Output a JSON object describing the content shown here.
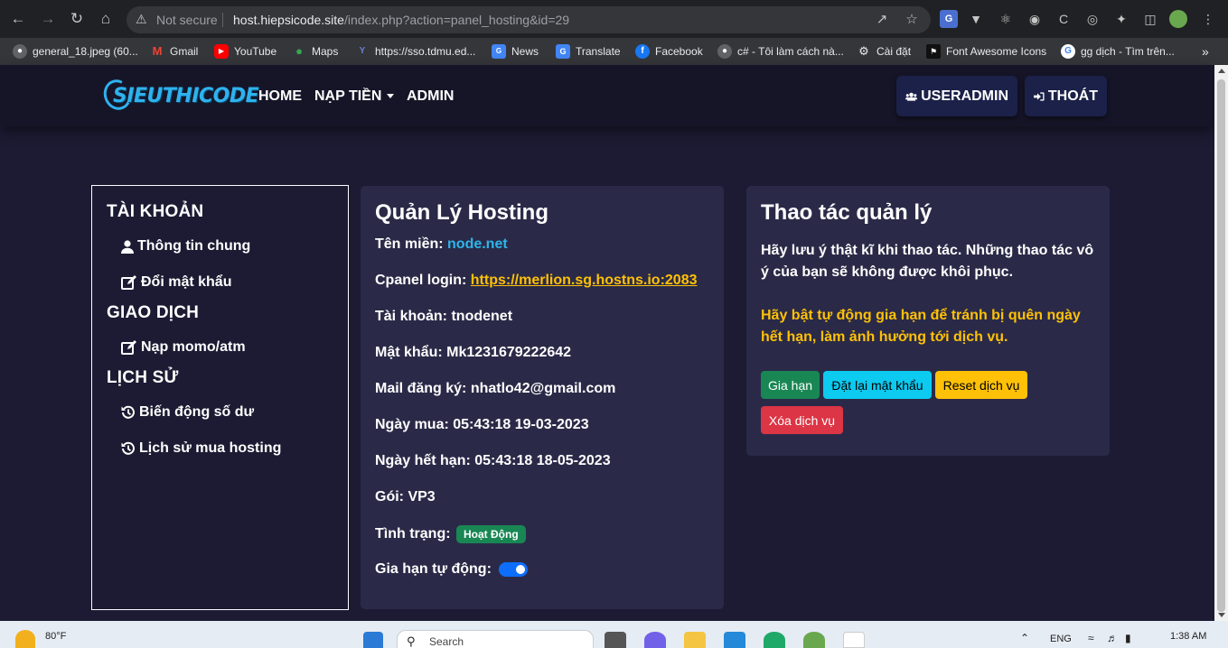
{
  "browser": {
    "not_secure": "Not secure",
    "url_host": "host.hiepsicode.site",
    "url_path": "/index.php?action=panel_hosting&id=29",
    "bookmarks": [
      {
        "label": "general_18.jpeg (60...",
        "icon": "globe-icon",
        "color": "#5f6368"
      },
      {
        "label": "Gmail",
        "icon": "gmail-icon",
        "color": "#ea4335"
      },
      {
        "label": "YouTube",
        "icon": "youtube-icon",
        "color": "#ff0000"
      },
      {
        "label": "Maps",
        "icon": "maps-icon",
        "color": "#34a853"
      },
      {
        "label": "https://sso.tdmu.ed...",
        "icon": "tdmu-icon",
        "color": "#3c4fa0"
      },
      {
        "label": "News",
        "icon": "news-icon",
        "color": "#4285f4"
      },
      {
        "label": "Translate",
        "icon": "translate-icon",
        "color": "#4285f4"
      },
      {
        "label": "Facebook",
        "icon": "facebook-icon",
        "color": "#1877f2"
      },
      {
        "label": "c# - Tôi làm cách nà...",
        "icon": "globe-icon",
        "color": "#5f6368"
      },
      {
        "label": "Cài đặt",
        "icon": "gear-icon",
        "color": "#5f6368"
      },
      {
        "label": "Font Awesome Icons",
        "icon": "fontawesome-icon",
        "color": "#111111"
      },
      {
        "label": "gg dịch - Tìm trên...",
        "icon": "google-icon",
        "color": "#ffffff"
      }
    ],
    "more_bookmarks": "»"
  },
  "header": {
    "logo_text": "SIEUTHICODE",
    "menu": {
      "home": "HOME",
      "nap_tien": "NẠP TIỀN",
      "admin": "ADMIN"
    },
    "user_button": "USERADMIN",
    "logout_button": "THOÁT"
  },
  "sidebar": {
    "section_account": "TÀI KHOẢN",
    "link_info": "Thông tin chung",
    "link_password": "Đổi mật khẩu",
    "section_transaction": "GIAO DỊCH",
    "link_topup": "Nạp momo/atm",
    "section_history": "LỊCH SỬ",
    "link_balance": "Biến động số dư",
    "link_purchase": "Lịch sử mua hosting"
  },
  "hosting": {
    "title": "Quản Lý Hosting",
    "domain_label": "Tên miền:",
    "domain_value": "node.net",
    "cpanel_label": "Cpanel login:",
    "cpanel_value": "https://merlion.sg.hostns.io:2083",
    "account_label": "Tài khoản:",
    "account_value": "tnodenet",
    "password_label": "Mật khẩu:",
    "password_value": "Mk1231679222642",
    "mail_label": "Mail đăng ký:",
    "mail_value": "nhatlo42@gmail.com",
    "buy_date_label": "Ngày mua:",
    "buy_date_value": "05:43:18 19-03-2023",
    "expiry_label": "Ngày hết hạn:",
    "expiry_value": "05:43:18 18-05-2023",
    "plan_label": "Gói:",
    "plan_value": "VP3",
    "status_label": "Tình trạng:",
    "status_value": "Hoạt Động",
    "auto_renew_label": "Gia hạn tự động:",
    "auto_renew_on": true
  },
  "actions": {
    "title": "Thao tác quản lý",
    "warning": "Hãy lưu ý thật kĩ khi thao tác. Những thao tác vô ý của bạn sẽ không được khôi phục.",
    "notice": "Hãy bật tự động gia hạn để tránh bị quên ngày hết hạn, làm ảnh hưởng tới dịch vụ.",
    "btn_renew": "Gia hạn",
    "btn_reset_password": "Đặt lại mật khẩu",
    "btn_reset_service": "Reset dịch vụ",
    "btn_delete": "Xóa dịch vụ",
    "colors": {
      "renew": "#198754",
      "reset_password": "#0dcaf0",
      "reset_service": "#ffc107",
      "delete": "#dc3545",
      "notice_text": "#ffc107"
    }
  },
  "taskbar": {
    "weather": "80°F",
    "search_placeholder": "Search",
    "language": "ENG",
    "time": "1:38 AM"
  }
}
